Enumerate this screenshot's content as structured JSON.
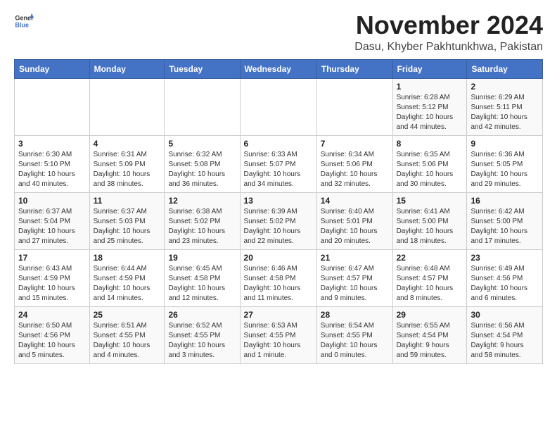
{
  "header": {
    "logo_general": "General",
    "logo_blue": "Blue",
    "month_title": "November 2024",
    "location": "Dasu, Khyber Pakhtunkhwa, Pakistan"
  },
  "weekdays": [
    "Sunday",
    "Monday",
    "Tuesday",
    "Wednesday",
    "Thursday",
    "Friday",
    "Saturday"
  ],
  "weeks": [
    [
      {
        "day": "",
        "info": ""
      },
      {
        "day": "",
        "info": ""
      },
      {
        "day": "",
        "info": ""
      },
      {
        "day": "",
        "info": ""
      },
      {
        "day": "",
        "info": ""
      },
      {
        "day": "1",
        "info": "Sunrise: 6:28 AM\nSunset: 5:12 PM\nDaylight: 10 hours\nand 44 minutes."
      },
      {
        "day": "2",
        "info": "Sunrise: 6:29 AM\nSunset: 5:11 PM\nDaylight: 10 hours\nand 42 minutes."
      }
    ],
    [
      {
        "day": "3",
        "info": "Sunrise: 6:30 AM\nSunset: 5:10 PM\nDaylight: 10 hours\nand 40 minutes."
      },
      {
        "day": "4",
        "info": "Sunrise: 6:31 AM\nSunset: 5:09 PM\nDaylight: 10 hours\nand 38 minutes."
      },
      {
        "day": "5",
        "info": "Sunrise: 6:32 AM\nSunset: 5:08 PM\nDaylight: 10 hours\nand 36 minutes."
      },
      {
        "day": "6",
        "info": "Sunrise: 6:33 AM\nSunset: 5:07 PM\nDaylight: 10 hours\nand 34 minutes."
      },
      {
        "day": "7",
        "info": "Sunrise: 6:34 AM\nSunset: 5:06 PM\nDaylight: 10 hours\nand 32 minutes."
      },
      {
        "day": "8",
        "info": "Sunrise: 6:35 AM\nSunset: 5:06 PM\nDaylight: 10 hours\nand 30 minutes."
      },
      {
        "day": "9",
        "info": "Sunrise: 6:36 AM\nSunset: 5:05 PM\nDaylight: 10 hours\nand 29 minutes."
      }
    ],
    [
      {
        "day": "10",
        "info": "Sunrise: 6:37 AM\nSunset: 5:04 PM\nDaylight: 10 hours\nand 27 minutes."
      },
      {
        "day": "11",
        "info": "Sunrise: 6:37 AM\nSunset: 5:03 PM\nDaylight: 10 hours\nand 25 minutes."
      },
      {
        "day": "12",
        "info": "Sunrise: 6:38 AM\nSunset: 5:02 PM\nDaylight: 10 hours\nand 23 minutes."
      },
      {
        "day": "13",
        "info": "Sunrise: 6:39 AM\nSunset: 5:02 PM\nDaylight: 10 hours\nand 22 minutes."
      },
      {
        "day": "14",
        "info": "Sunrise: 6:40 AM\nSunset: 5:01 PM\nDaylight: 10 hours\nand 20 minutes."
      },
      {
        "day": "15",
        "info": "Sunrise: 6:41 AM\nSunset: 5:00 PM\nDaylight: 10 hours\nand 18 minutes."
      },
      {
        "day": "16",
        "info": "Sunrise: 6:42 AM\nSunset: 5:00 PM\nDaylight: 10 hours\nand 17 minutes."
      }
    ],
    [
      {
        "day": "17",
        "info": "Sunrise: 6:43 AM\nSunset: 4:59 PM\nDaylight: 10 hours\nand 15 minutes."
      },
      {
        "day": "18",
        "info": "Sunrise: 6:44 AM\nSunset: 4:59 PM\nDaylight: 10 hours\nand 14 minutes."
      },
      {
        "day": "19",
        "info": "Sunrise: 6:45 AM\nSunset: 4:58 PM\nDaylight: 10 hours\nand 12 minutes."
      },
      {
        "day": "20",
        "info": "Sunrise: 6:46 AM\nSunset: 4:58 PM\nDaylight: 10 hours\nand 11 minutes."
      },
      {
        "day": "21",
        "info": "Sunrise: 6:47 AM\nSunset: 4:57 PM\nDaylight: 10 hours\nand 9 minutes."
      },
      {
        "day": "22",
        "info": "Sunrise: 6:48 AM\nSunset: 4:57 PM\nDaylight: 10 hours\nand 8 minutes."
      },
      {
        "day": "23",
        "info": "Sunrise: 6:49 AM\nSunset: 4:56 PM\nDaylight: 10 hours\nand 6 minutes."
      }
    ],
    [
      {
        "day": "24",
        "info": "Sunrise: 6:50 AM\nSunset: 4:56 PM\nDaylight: 10 hours\nand 5 minutes."
      },
      {
        "day": "25",
        "info": "Sunrise: 6:51 AM\nSunset: 4:55 PM\nDaylight: 10 hours\nand 4 minutes."
      },
      {
        "day": "26",
        "info": "Sunrise: 6:52 AM\nSunset: 4:55 PM\nDaylight: 10 hours\nand 3 minutes."
      },
      {
        "day": "27",
        "info": "Sunrise: 6:53 AM\nSunset: 4:55 PM\nDaylight: 10 hours\nand 1 minute."
      },
      {
        "day": "28",
        "info": "Sunrise: 6:54 AM\nSunset: 4:55 PM\nDaylight: 10 hours\nand 0 minutes."
      },
      {
        "day": "29",
        "info": "Sunrise: 6:55 AM\nSunset: 4:54 PM\nDaylight: 9 hours\nand 59 minutes."
      },
      {
        "day": "30",
        "info": "Sunrise: 6:56 AM\nSunset: 4:54 PM\nDaylight: 9 hours\nand 58 minutes."
      }
    ]
  ]
}
